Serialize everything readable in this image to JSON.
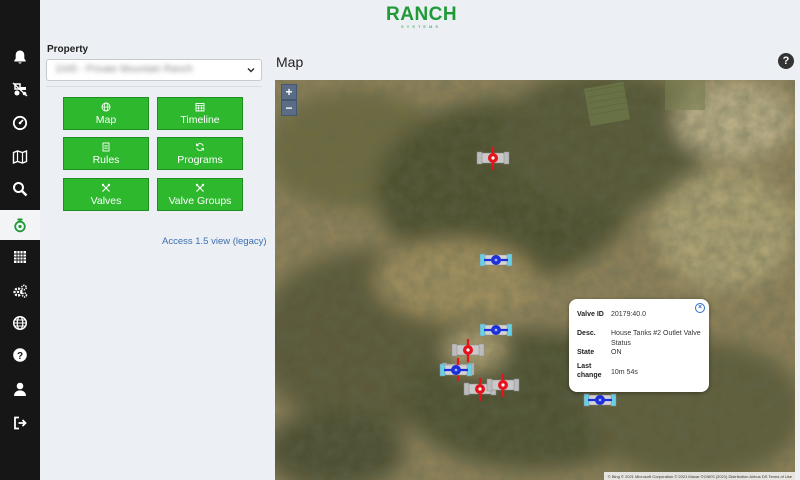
{
  "header": {
    "logo_main": "RANCH",
    "logo_sub": "SYSTEMS"
  },
  "sidebar": {
    "items": [
      {
        "icon": "bell-icon",
        "active": false
      },
      {
        "icon": "tractor-icon",
        "active": false
      },
      {
        "icon": "gauge-icon",
        "active": false
      },
      {
        "icon": "map-icon",
        "active": false
      },
      {
        "icon": "search-icon",
        "active": false
      },
      {
        "icon": "valve-icon",
        "active": true
      },
      {
        "icon": "grid-icon",
        "active": false
      },
      {
        "icon": "gears-icon",
        "active": false
      },
      {
        "icon": "globe-icon",
        "active": false
      },
      {
        "icon": "question-icon",
        "active": false
      },
      {
        "icon": "user-icon",
        "active": false
      },
      {
        "icon": "sign-out-icon",
        "active": false
      }
    ]
  },
  "property": {
    "label": "Property",
    "selected": "1045 - Private Mountain Ranch"
  },
  "nav_buttons": [
    {
      "label": "Map",
      "icon": "globe-icon"
    },
    {
      "label": "Timeline",
      "icon": "calendar-icon"
    },
    {
      "label": "Rules",
      "icon": "list-icon"
    },
    {
      "label": "Programs",
      "icon": "refresh-icon"
    },
    {
      "label": "Valves",
      "icon": "tools-icon"
    },
    {
      "label": "Valve Groups",
      "icon": "tools-icon"
    }
  ],
  "legacy_link": "Access 1.5 view (legacy)",
  "map": {
    "title": "Map",
    "zoom_in": "+",
    "zoom_out": "−",
    "attribution": "© Bing  © 2021 Microsoft Corporation © 2021 Maxar ©CNES (2021) Distribution Airbus DS  Terms of Use"
  },
  "valves": [
    {
      "state": "ON",
      "color": "#e5141b"
    },
    {
      "state": "OFF",
      "color": "#1c2fd8"
    },
    {
      "state": "OFF",
      "color": "#1c2fd8"
    },
    {
      "state": "ON",
      "color": "#e5141b"
    },
    {
      "state": "ON",
      "color": "#e5141b"
    },
    {
      "state": "OFF",
      "color": "#1c2fd8"
    },
    {
      "state": "ON",
      "color": "#e5141b"
    },
    {
      "state": "ON",
      "color": "#e5141b"
    },
    {
      "state": "OFF",
      "color": "#1c2fd8"
    }
  ],
  "popup": {
    "rows": [
      {
        "key": "Valve ID",
        "value": "20179:40.0"
      },
      {
        "key": "Desc.",
        "value": "House Tanks #2 Outlet Valve Status"
      },
      {
        "key": "State",
        "value": "ON"
      },
      {
        "key": "Last change",
        "value": "10m 54s"
      }
    ]
  },
  "colors": {
    "accent_green": "#2eb82e",
    "valve_on": "#e5141b",
    "valve_off": "#1c2fd8",
    "link": "#3a6fb0"
  }
}
